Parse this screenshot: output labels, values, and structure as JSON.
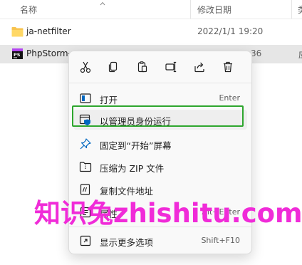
{
  "explorer": {
    "columns": {
      "name": "名称",
      "date_modified": "修改日期",
      "type_partial": "类"
    },
    "files": [
      {
        "name": "ja-netfilter",
        "date": "2022/1/1 19:20",
        "icon": "folder-icon"
      },
      {
        "name": "PhpStorm-",
        "date_partial": "36",
        "icon": "phpstorm-icon",
        "type_partial": "应"
      }
    ]
  },
  "context_menu": {
    "actions": [
      {
        "name": "cut",
        "icon": "scissors-icon"
      },
      {
        "name": "copy",
        "icon": "copy-icon"
      },
      {
        "name": "paste",
        "icon": "paste-icon"
      },
      {
        "name": "rename",
        "icon": "rename-icon"
      },
      {
        "name": "share",
        "icon": "share-icon"
      },
      {
        "name": "delete",
        "icon": "trash-icon"
      }
    ],
    "items": [
      {
        "label": "打开",
        "shortcut": "Enter",
        "icon": "open-icon"
      },
      {
        "label": "以管理员身份运行",
        "icon": "admin-shield-icon"
      },
      {
        "label": "固定到“开始”屏幕",
        "icon": "pin-icon"
      },
      {
        "label": "压缩为 ZIP 文件",
        "icon": "zip-icon"
      },
      {
        "label": "复制文件地址",
        "icon": "copy-path-icon"
      },
      {
        "label": "属性",
        "shortcut": "Alt+Enter",
        "icon": "properties-icon"
      },
      {
        "label": "显示更多选项",
        "shortcut": "Shift+F10",
        "icon": "more-options-icon"
      }
    ]
  },
  "watermark": {
    "text": "知识兔zhishitu.com",
    "color": "#f02bd8"
  },
  "colors": {
    "highlight": "#2ea62e",
    "accent": "#0067c0",
    "selected_row": "#e6e6e6"
  }
}
